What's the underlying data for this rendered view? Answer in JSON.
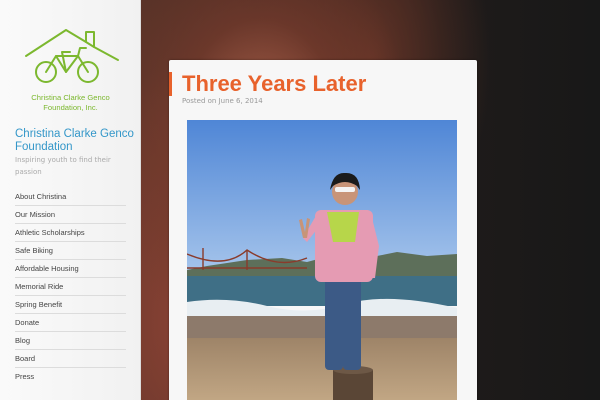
{
  "logo": {
    "caption_line1": "Christina Clarke Genco",
    "caption_line2": "Foundation, Inc.",
    "icon": "house-bicycle-icon",
    "color": "#7cb82f"
  },
  "site": {
    "title": "Christina Clarke Genco Foundation",
    "description": "Inspiring youth to find their passion",
    "title_color": "#3497c9"
  },
  "nav": {
    "items": [
      {
        "label": "About Christina"
      },
      {
        "label": "Our Mission"
      },
      {
        "label": "Athletic Scholarships"
      },
      {
        "label": "Safe Biking"
      },
      {
        "label": "Affordable Housing"
      },
      {
        "label": "Memorial Ride"
      },
      {
        "label": "Spring Benefit"
      },
      {
        "label": "Donate"
      },
      {
        "label": "Blog"
      },
      {
        "label": "Board"
      },
      {
        "label": "Press"
      }
    ]
  },
  "post": {
    "title": "Three Years Later",
    "meta": "Posted on June 6, 2014",
    "accent_color": "#e8622c"
  }
}
